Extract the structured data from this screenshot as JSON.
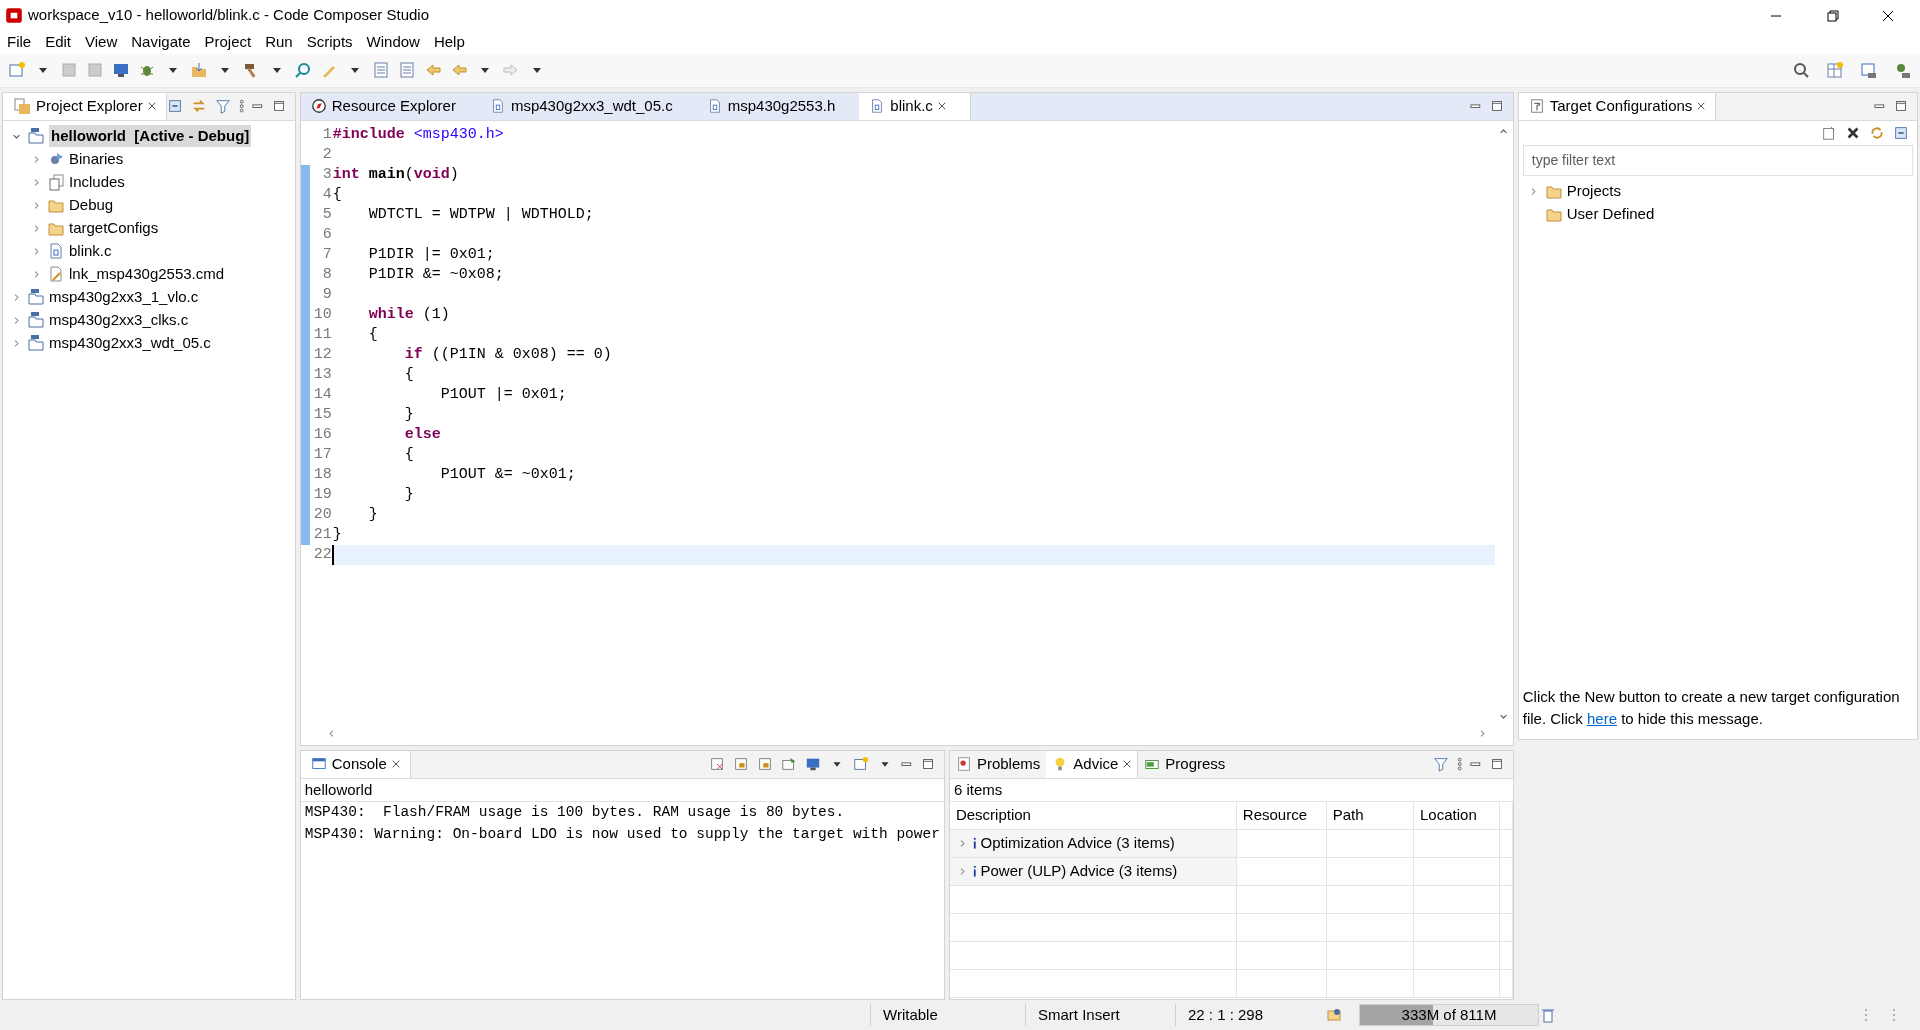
{
  "window": {
    "title": "workspace_v10 - helloworld/blink.c - Code Composer Studio"
  },
  "menu": [
    "File",
    "Edit",
    "View",
    "Navigate",
    "Project",
    "Run",
    "Scripts",
    "Window",
    "Help"
  ],
  "project_explorer": {
    "title": "Project Explorer",
    "items": [
      {
        "label": "helloworld",
        "suffix": "[Active - Debug]",
        "kind": "project",
        "expanded": true,
        "selected": true,
        "children": [
          {
            "label": "Binaries",
            "kind": "binaries",
            "expanded": false,
            "selected": false
          },
          {
            "label": "Includes",
            "kind": "includes",
            "expanded": false,
            "selected": false
          },
          {
            "label": "Debug",
            "kind": "folder",
            "expanded": false,
            "selected": false
          },
          {
            "label": "targetConfigs",
            "kind": "folder",
            "expanded": false,
            "selected": false
          },
          {
            "label": "blink.c",
            "kind": "cfile",
            "expanded": false,
            "selected": false
          },
          {
            "label": "lnk_msp430g2553.cmd",
            "kind": "cmd",
            "expanded": false,
            "selected": false
          }
        ]
      },
      {
        "label": "msp430g2xx3_1_vlo.c",
        "kind": "project",
        "expanded": false,
        "selected": false
      },
      {
        "label": "msp430g2xx3_clks.c",
        "kind": "project",
        "expanded": false,
        "selected": false
      },
      {
        "label": "msp430g2xx3_wdt_05.c",
        "kind": "project",
        "expanded": false,
        "selected": false
      }
    ]
  },
  "editor": {
    "tabs": [
      {
        "label": "Resource Explorer",
        "kind": "explorer",
        "selected": false,
        "closable": false
      },
      {
        "label": "msp430g2xx3_wdt_05.c",
        "kind": "cfile",
        "selected": false,
        "closable": false
      },
      {
        "label": "msp430g2553.h",
        "kind": "cfile",
        "selected": false,
        "closable": false
      },
      {
        "label": "blink.c",
        "kind": "cfile",
        "selected": true,
        "closable": true
      }
    ],
    "lines": [
      {
        "number": "1",
        "changed": false,
        "current": false,
        "tokens": [
          {
            "kind": "keyword",
            "text": "#include"
          },
          {
            "kind": "string",
            "text": " <msp430.h>"
          }
        ]
      },
      {
        "number": "2",
        "changed": false,
        "current": false
      },
      {
        "number": "3",
        "changed": true,
        "current": false,
        "tokens": [
          {
            "kind": "keyword",
            "text": "int"
          },
          {
            "kind": "bold",
            "text": " main"
          },
          {
            "kind": "plain",
            "text": "("
          },
          {
            "kind": "keyword",
            "text": "void"
          },
          {
            "kind": "plain",
            "text": ")"
          }
        ]
      },
      {
        "number": "4",
        "changed": true,
        "current": false,
        "tokens": [
          {
            "kind": "plain",
            "text": "{"
          }
        ]
      },
      {
        "number": "5",
        "changed": true,
        "current": false,
        "tokens": [
          {
            "kind": "plain",
            "text": "    WDTCTL = WDTPW | WDTHOLD;"
          }
        ]
      },
      {
        "number": "6",
        "changed": true,
        "current": false
      },
      {
        "number": "7",
        "changed": true,
        "current": false,
        "tokens": [
          {
            "kind": "plain",
            "text": "    P1DIR |= 0x01;"
          }
        ]
      },
      {
        "number": "8",
        "changed": true,
        "current": false,
        "tokens": [
          {
            "kind": "plain",
            "text": "    P1DIR &= ~0x08;"
          }
        ]
      },
      {
        "number": "9",
        "changed": true,
        "current": false
      },
      {
        "number": "10",
        "changed": true,
        "current": false,
        "tokens": [
          {
            "kind": "keyword",
            "text": "    while"
          },
          {
            "kind": "plain",
            "text": " (1)"
          }
        ]
      },
      {
        "number": "11",
        "changed": true,
        "current": false,
        "tokens": [
          {
            "kind": "plain",
            "text": "    {"
          }
        ]
      },
      {
        "number": "12",
        "changed": true,
        "current": false,
        "tokens": [
          {
            "kind": "keyword",
            "text": "        if"
          },
          {
            "kind": "plain",
            "text": " ((P1IN & 0x08) == 0)"
          }
        ]
      },
      {
        "number": "13",
        "changed": true,
        "current": false,
        "tokens": [
          {
            "kind": "plain",
            "text": "        {"
          }
        ]
      },
      {
        "number": "14",
        "changed": true,
        "current": false,
        "tokens": [
          {
            "kind": "plain",
            "text": "            P1OUT |= 0x01;"
          }
        ]
      },
      {
        "number": "15",
        "changed": true,
        "current": false,
        "tokens": [
          {
            "kind": "plain",
            "text": "        }"
          }
        ]
      },
      {
        "number": "16",
        "changed": true,
        "current": false,
        "tokens": [
          {
            "kind": "keyword",
            "text": "        else"
          }
        ]
      },
      {
        "number": "17",
        "changed": true,
        "current": false,
        "tokens": [
          {
            "kind": "plain",
            "text": "        {"
          }
        ]
      },
      {
        "number": "18",
        "changed": true,
        "current": false,
        "tokens": [
          {
            "kind": "plain",
            "text": "            P1OUT &= ~0x01;"
          }
        ]
      },
      {
        "number": "19",
        "changed": true,
        "current": false,
        "tokens": [
          {
            "kind": "plain",
            "text": "        }"
          }
        ]
      },
      {
        "number": "20",
        "changed": true,
        "current": false,
        "tokens": [
          {
            "kind": "plain",
            "text": "    }"
          }
        ]
      },
      {
        "number": "21",
        "changed": true,
        "current": false,
        "tokens": [
          {
            "kind": "plain",
            "text": "}"
          }
        ]
      },
      {
        "number": "22",
        "changed": false,
        "current": true
      }
    ]
  },
  "target_configurations": {
    "title": "Target Configurations",
    "filter": {
      "placeholder": "type filter text"
    },
    "items": [
      {
        "label": "Projects",
        "expanded": false
      },
      {
        "label": "User Defined"
      }
    ],
    "message": {
      "before": "Click the New button to create a new target configuration file. Click",
      "link": "here",
      "after": "to hide this message."
    }
  },
  "console": {
    "title": "Console",
    "project": "helloworld",
    "lines": [
      "MSP430:  Flash/FRAM usage is 100 bytes. RAM usage is 80 bytes.",
      "MSP430: Warning: On-board LDO is now used to supply the target with power"
    ]
  },
  "advice": {
    "tabs": [
      {
        "label": "Problems",
        "kind": "problems",
        "selected": false
      },
      {
        "label": "Advice",
        "kind": "advice",
        "selected": true
      },
      {
        "label": "Progress",
        "kind": "progress",
        "selected": false
      }
    ],
    "count": "6 items",
    "columns": [
      "Description",
      "Resource",
      "Path",
      "Location"
    ],
    "rows": [
      {
        "description": "Optimization Advice (3 items)",
        "expanded": false
      },
      {
        "description": "Power (ULP) Advice (3 items)",
        "expanded": false
      }
    ]
  },
  "status_bar": {
    "mode": "Writable",
    "insert": "Smart Insert",
    "position": "22 : 1 : 298",
    "memory": {
      "text": "333M of 811M",
      "level": 0.41
    }
  }
}
